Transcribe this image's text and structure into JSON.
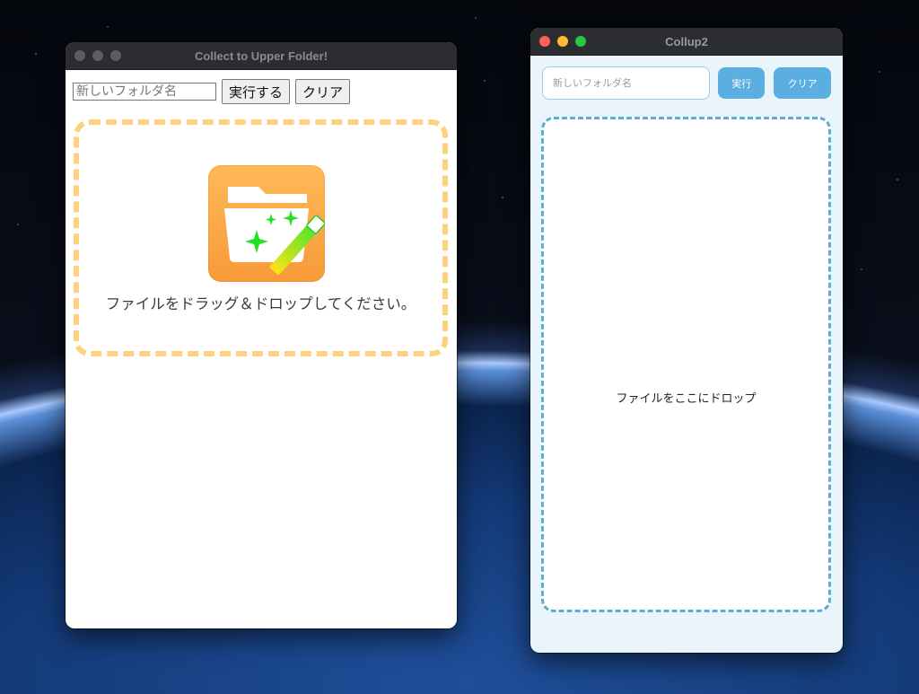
{
  "window1": {
    "title": "Collect to Upper Folder!",
    "folder_name_placeholder": "新しいフォルダ名",
    "run_label": "実行する",
    "clear_label": "クリア",
    "drop_text": "ファイルをドラッグ＆ドロップしてください。",
    "app_icon": "folder-magic-wand-icon",
    "colors": {
      "dropzone_border": "#fed27d",
      "icon_bg": "#f9a543",
      "sparkle": "#22e022"
    }
  },
  "window2": {
    "title": "Collup2",
    "folder_name_placeholder": "新しいフォルダ名",
    "run_label": "実行",
    "clear_label": "クリア",
    "drop_text": "ファイルをここにドロップ",
    "colors": {
      "accent": "#5aaee0",
      "dropzone_border": "#5baed6",
      "background": "#e9f4fb"
    }
  }
}
